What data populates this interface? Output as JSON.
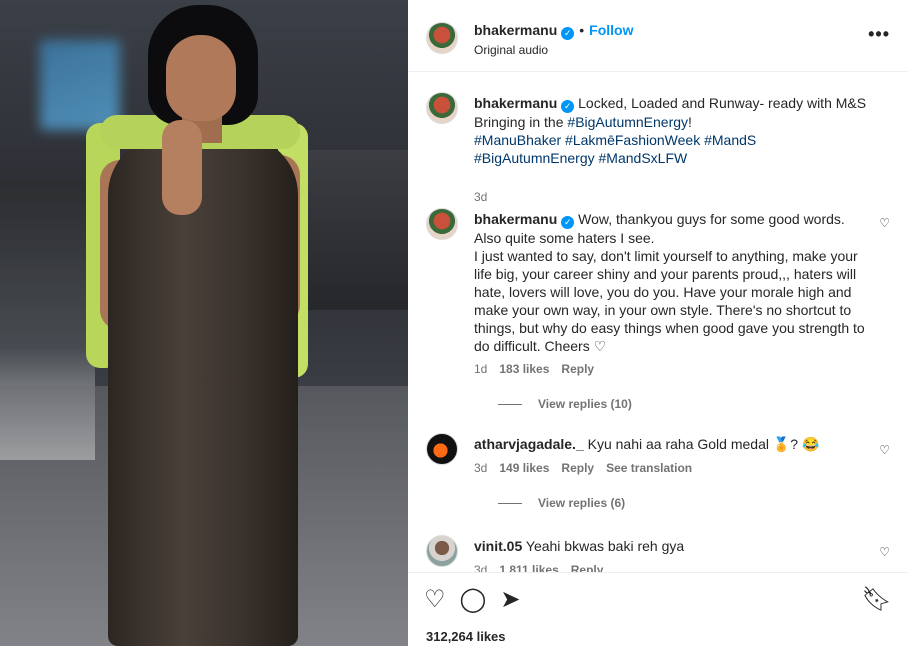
{
  "post": {
    "username": "bhakermanu",
    "follow_label": "Follow",
    "audio": "Original audio",
    "more_icon": "more-horizontal-icon"
  },
  "caption": {
    "username": "bhakermanu",
    "text_pre": "Locked, Loaded and Runway- ready with M&S Bringing in the ",
    "tag1": "#BigAutumnEnergy",
    "text_post": "!",
    "tags2": "#ManuBhaker #LakmēFashionWeek #MandS #BigAutumnEnergy #MandSxLFW",
    "age": "3d"
  },
  "comments": [
    {
      "username": "bhakermanu",
      "text": "Wow, thankyou guys for some good words. Also quite some haters I see.\nI just wanted to say, don't limit yourself to anything, make your life big, your career shiny and your parents proud,,, haters will hate, lovers will love, you do you. Have your morale high and make your own way, in your own style. There's no shortcut to things, but why do easy things when good gave you strength to do difficult. Cheers ♡",
      "age": "1d",
      "likes": "183 likes",
      "reply": "Reply",
      "replies": "View replies (10)"
    },
    {
      "username": "atharvjagadale._",
      "text": "Kyu nahi aa raha Gold medal 🏅? 😂",
      "age": "3d",
      "likes": "149 likes",
      "reply": "Reply",
      "translate": "See translation",
      "replies": "View replies (6)"
    },
    {
      "username": "vinit.05",
      "text": "Yeahi bkwas baki reh gya",
      "age": "3d",
      "likes": "1,811 likes",
      "reply": "Reply"
    }
  ],
  "footer": {
    "likes": "312,264 likes",
    "icons": [
      "heart-icon",
      "comment-icon",
      "share-icon",
      "bookmark-icon"
    ]
  },
  "colors": {
    "link": "#0095f6",
    "hashtag": "#00376b",
    "muted": "#737373",
    "sweater": "#b8d65a"
  }
}
